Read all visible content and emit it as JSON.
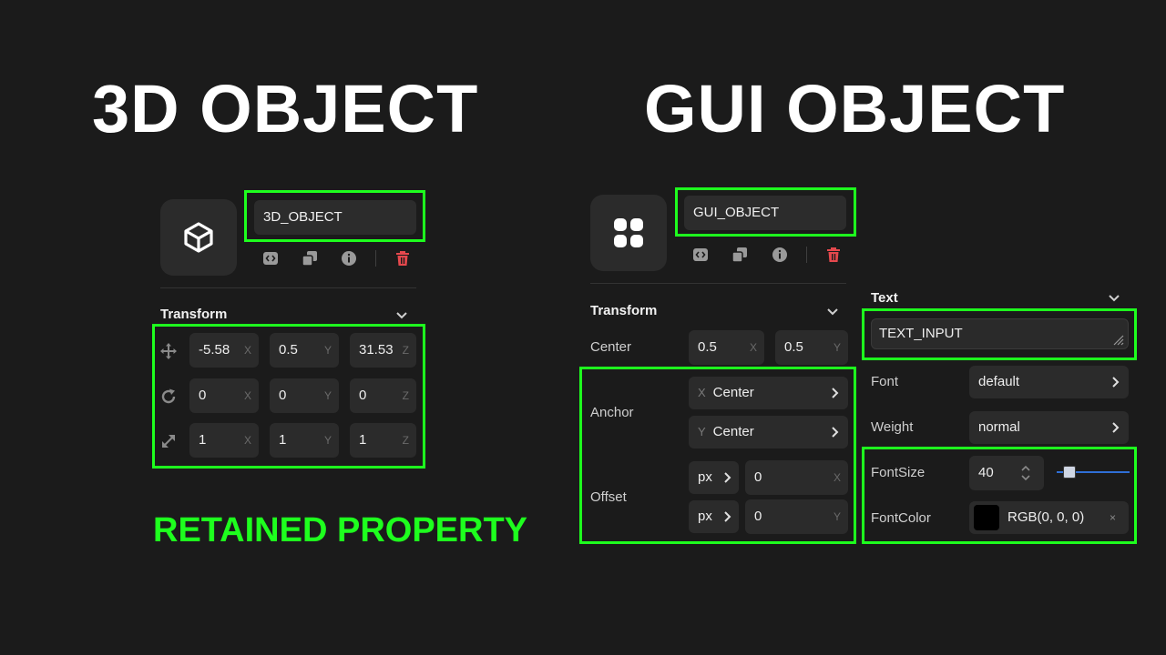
{
  "headings": {
    "left": "3D OBJECT",
    "right": "GUI OBJECT"
  },
  "caption": "RETAINED PROPERTY",
  "colors": {
    "highlight": "#1eff1e",
    "delete": "#e5484d",
    "background": "#1b1b1b"
  },
  "left_panel": {
    "name": "3D_OBJECT",
    "icon": "cube-icon",
    "toolbar": [
      "code-icon",
      "duplicate-icon",
      "info-icon",
      "trash-icon"
    ],
    "transform": {
      "title": "Transform",
      "rows": [
        {
          "icon": "move-icon",
          "x": "-5.58",
          "y": "0.5",
          "z": "31.53"
        },
        {
          "icon": "rotate-icon",
          "x": "0",
          "y": "0",
          "z": "0"
        },
        {
          "icon": "scale-icon",
          "x": "1",
          "y": "1",
          "z": "1"
        }
      ],
      "axes": {
        "x": "X",
        "y": "Y",
        "z": "Z"
      }
    }
  },
  "right_panel": {
    "name": "GUI_OBJECT",
    "icon": "grid-icon",
    "toolbar": [
      "code-icon",
      "duplicate-icon",
      "info-icon",
      "trash-icon"
    ],
    "transform": {
      "title": "Transform",
      "center_label": "Center",
      "center_x": "0.5",
      "center_y": "0.5",
      "anchor_label": "Anchor",
      "anchor_x": "Center",
      "anchor_y": "Center",
      "offset_label": "Offset",
      "offset_unit_x": "px",
      "offset_unit_y": "px",
      "offset_x": "0",
      "offset_y": "0",
      "axis_x": "X",
      "axis_y": "Y"
    },
    "text": {
      "title": "Text",
      "input_value": "TEXT_INPUT",
      "font_label": "Font",
      "font_value": "default",
      "weight_label": "Weight",
      "weight_value": "normal",
      "fontsize_label": "FontSize",
      "fontsize_value": "40",
      "fontsize_slider_fraction": 0.1,
      "fontcolor_label": "FontColor",
      "fontcolor_value": "RGB(0, 0, 0)",
      "fontcolor_clear": "×"
    }
  }
}
